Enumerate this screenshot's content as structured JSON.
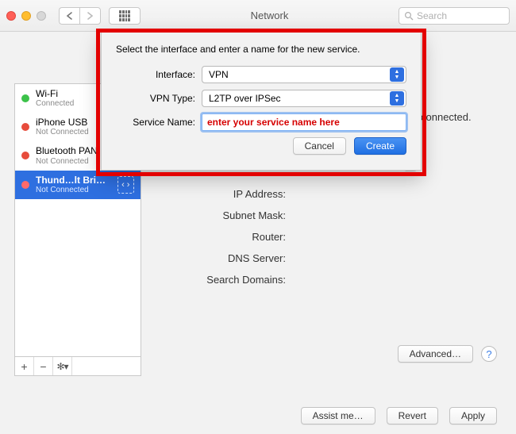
{
  "window": {
    "title": "Network",
    "search_placeholder": "Search"
  },
  "sidebar": {
    "items": [
      {
        "name": "Wi-Fi",
        "status": "Connected",
        "dot": "green",
        "selected": false
      },
      {
        "name": "iPhone USB",
        "status": "Not Connected",
        "dot": "red",
        "selected": false
      },
      {
        "name": "Bluetooth PAN",
        "status": "Not Connected",
        "dot": "red",
        "selected": false
      },
      {
        "name": "Thund…lt Bridge",
        "status": "Not Connected",
        "dot": "red",
        "selected": true
      }
    ],
    "tools": {
      "add": "+",
      "remove": "−",
      "options": "✻▾"
    }
  },
  "panel": {
    "status_suffix": "connected.",
    "rows": {
      "ip": "IP Address:",
      "subnet": "Subnet Mask:",
      "router": "Router:",
      "dns": "DNS Server:",
      "search": "Search Domains:"
    },
    "advanced_btn": "Advanced…",
    "help": "?"
  },
  "footer": {
    "assist": "Assist me…",
    "revert": "Revert",
    "apply": "Apply"
  },
  "sheet": {
    "prompt": "Select the interface and enter a name for the new service.",
    "labels": {
      "interface": "Interface:",
      "vpntype": "VPN Type:",
      "service": "Service Name:"
    },
    "values": {
      "interface": "VPN",
      "vpntype": "L2TP over IPSec",
      "service": "enter your service name here"
    },
    "buttons": {
      "cancel": "Cancel",
      "create": "Create"
    }
  }
}
